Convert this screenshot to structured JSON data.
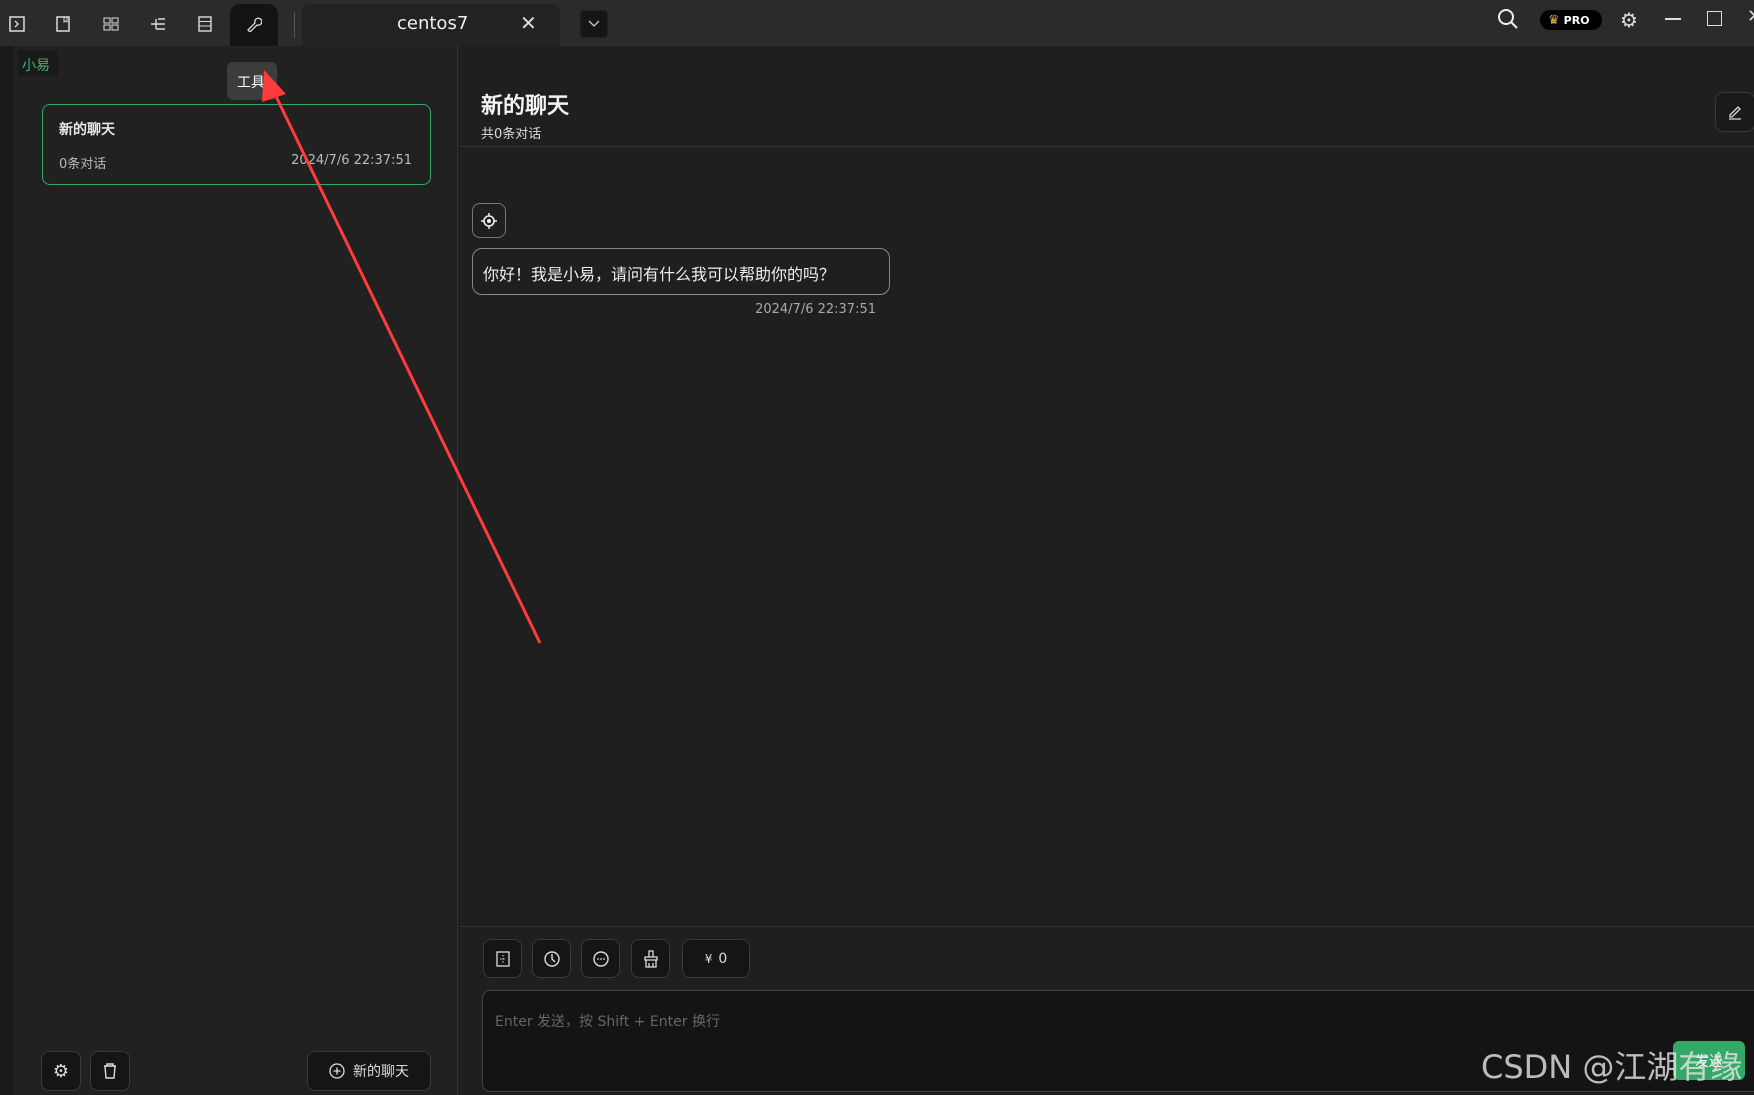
{
  "topbar": {
    "icons": [
      "terminal-icon",
      "bookmark-icon",
      "grid-icon",
      "tree-icon",
      "server-icon",
      "wrench-icon"
    ],
    "tab_label": "centos7",
    "tooltip": "工具",
    "pro_badge": "PRO"
  },
  "sidebar": {
    "assistant_tag": "小易",
    "chats": [
      {
        "title": "新的聊天",
        "count": "0条对话",
        "time": "2024/7/6 22:37:51"
      }
    ],
    "new_chat_label": "新的聊天"
  },
  "main": {
    "title": "新的聊天",
    "subtitle": "共0条对话",
    "messages": [
      {
        "text": "你好！我是小易，请问有什么我可以帮助你的吗？",
        "time": "2024/7/6 22:37:51"
      }
    ],
    "token_count": "0",
    "input_placeholder": "Enter 发送，按 Shift + Enter 换行",
    "send_label": "发送"
  },
  "watermark": "CSDN @江湖有缘",
  "colors": {
    "accent": "#34a867",
    "annotation": "#ff3b3b"
  }
}
